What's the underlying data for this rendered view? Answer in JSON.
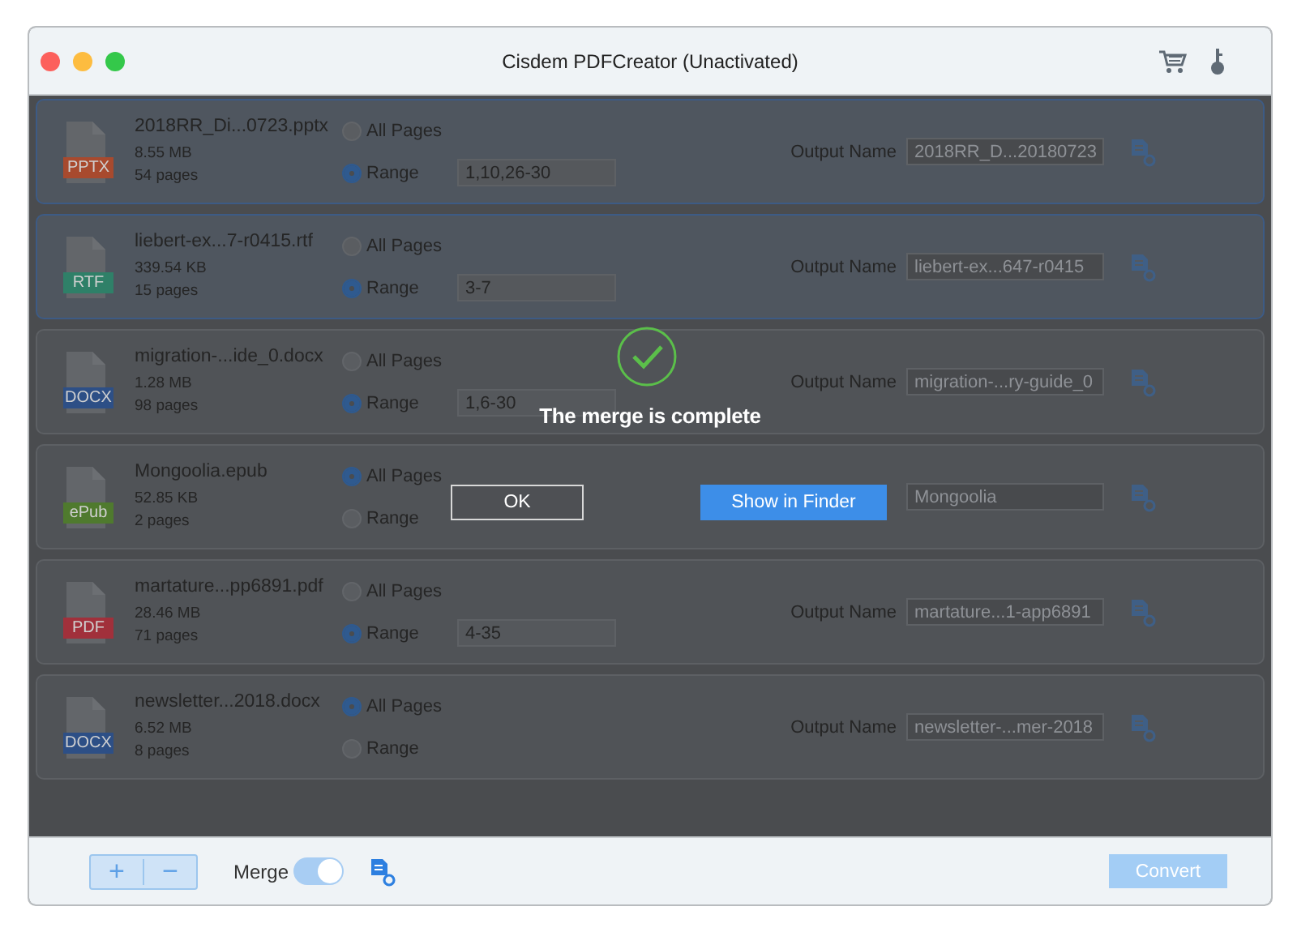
{
  "window": {
    "title": "Cisdem PDFCreator (Unactivated)"
  },
  "files": [
    {
      "name": "2018RR_Di...0723.pptx",
      "type": "PPTX",
      "color": "#a84a2e",
      "size": "8.55 MB",
      "pages": "54 pages",
      "selected": true,
      "options": [
        {
          "label": "All Pages",
          "selected": false
        },
        {
          "label": "Range",
          "selected": true
        }
      ],
      "range": "1,10,26-30",
      "output_label": "Output Name",
      "output_name": "2018RR_D...20180723"
    },
    {
      "name": "liebert-ex...7-r0415.rtf",
      "type": "RTF",
      "color": "#2f8068",
      "size": "339.54 KB",
      "pages": "15 pages",
      "selected": true,
      "options": [
        {
          "label": "All Pages",
          "selected": false
        },
        {
          "label": "Range",
          "selected": true
        }
      ],
      "range": "3-7",
      "output_label": "Output Name",
      "output_name": "liebert-ex...647-r0415"
    },
    {
      "name": "migration-...ide_0.docx",
      "type": "DOCX",
      "color": "#2d4f86",
      "size": "1.28 MB",
      "pages": "98 pages",
      "selected": false,
      "options": [
        {
          "label": "All Pages",
          "selected": false
        },
        {
          "label": "Range",
          "selected": true
        }
      ],
      "range": "1,6-30",
      "output_label": "Output Name",
      "output_name": "migration-...ry-guide_0"
    },
    {
      "name": "Mongoolia.epub",
      "type": "ePub",
      "color": "#4f7a2e",
      "size": "52.85 KB",
      "pages": "2 pages",
      "selected": false,
      "options": [
        {
          "label": "All Pages",
          "selected": true
        },
        {
          "label": "Range",
          "selected": false
        }
      ],
      "output_name": "Mongoolia"
    },
    {
      "name": "martature...pp6891.pdf",
      "type": "PDF",
      "color": "#a1303b",
      "size": "28.46 MB",
      "pages": "71 pages",
      "selected": false,
      "options": [
        {
          "label": "All Pages",
          "selected": false
        },
        {
          "label": "Range",
          "selected": true
        }
      ],
      "range": "4-35",
      "output_label": "Output Name",
      "output_name": "martature...1-app6891"
    },
    {
      "name": "newsletter...2018.docx",
      "type": "DOCX",
      "color": "#2d4f86",
      "size": "6.52 MB",
      "pages": "8 pages",
      "selected": false,
      "options": [
        {
          "label": "All Pages",
          "selected": true
        },
        {
          "label": "Range",
          "selected": false
        }
      ],
      "output_label": "Output Name",
      "output_name": "newsletter-...mer-2018"
    }
  ],
  "dialog": {
    "message": "The merge is complete",
    "buttons": [
      {
        "label": "OK",
        "kind": "plain"
      },
      {
        "label": "Show in Finder",
        "kind": "primary"
      }
    ]
  },
  "bottom_bar": {
    "add": "+",
    "remove": "−",
    "merge_label": "Merge",
    "merge_on": true,
    "convert": {
      "label": "Convert",
      "disabled": true
    }
  }
}
